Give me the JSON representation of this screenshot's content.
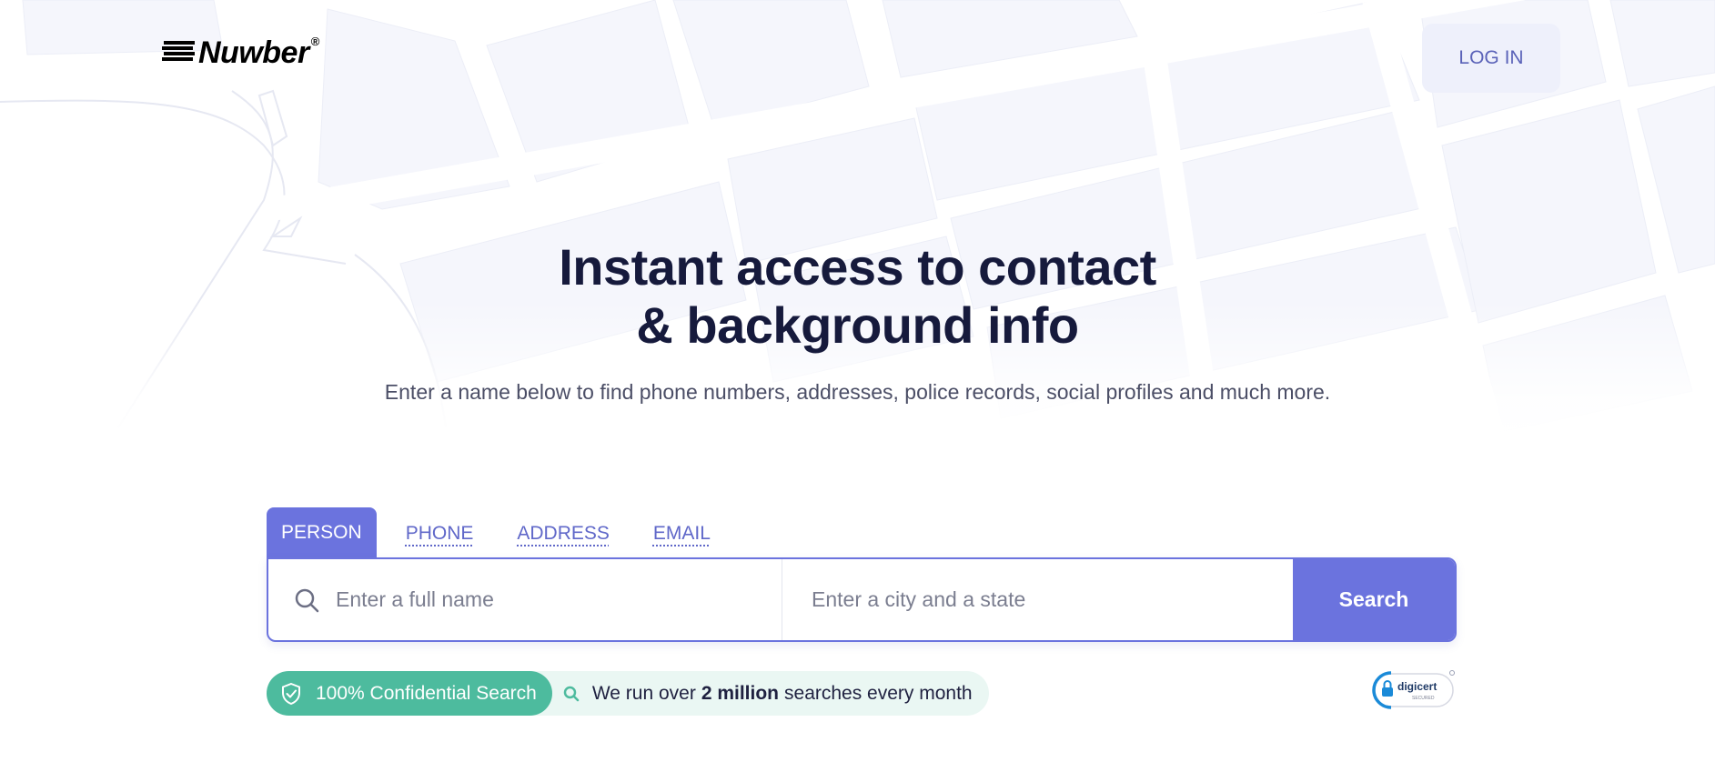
{
  "brand": {
    "name": "Nuwber",
    "registered_mark": "®"
  },
  "header": {
    "login_label": "LOG IN"
  },
  "hero": {
    "title_line1": "Instant access to contact",
    "title_line2": "& background info",
    "subtitle": "Enter a name below to find phone numbers, addresses, police records, social profiles and much more."
  },
  "search": {
    "tabs": [
      {
        "label": "PERSON",
        "active": true
      },
      {
        "label": "PHONE",
        "active": false
      },
      {
        "label": "ADDRESS",
        "active": false
      },
      {
        "label": "EMAIL",
        "active": false
      }
    ],
    "name_placeholder": "Enter a full name",
    "name_value": "",
    "location_placeholder": "Enter a city and a state",
    "location_value": "",
    "button_label": "Search"
  },
  "trust": {
    "confidential_label": "100% Confidential Search",
    "stat_prefix": "We run over",
    "stat_highlight": "2 million",
    "stat_suffix": "searches every month"
  },
  "badge": {
    "name": "digicert",
    "sub": "SECURED"
  },
  "colors": {
    "accent": "#6b73de",
    "accent_text": "#5a62b8",
    "success": "#4dbb9e",
    "success_bg": "#eaf7f3",
    "heading": "#161a3c"
  },
  "icons": [
    "search-icon",
    "shield-check-icon",
    "magnifier-small-icon",
    "lock-icon"
  ]
}
